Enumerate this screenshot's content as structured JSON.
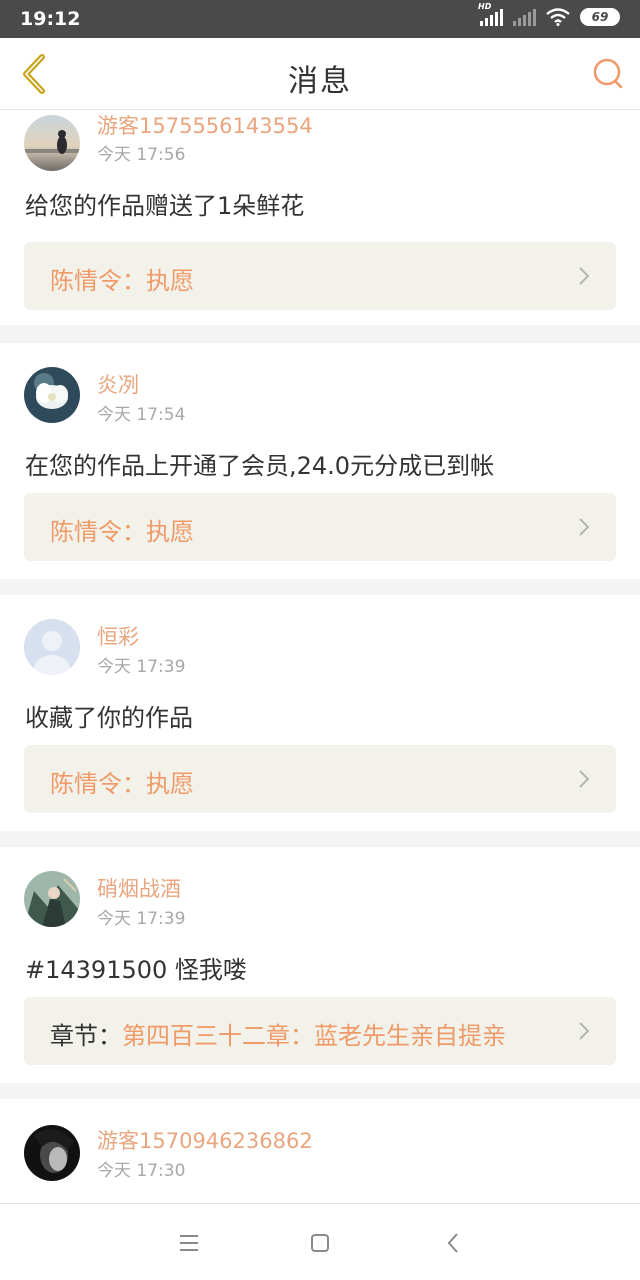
{
  "status_bar": {
    "time": "19:12",
    "hd_label": "HD",
    "battery": "69",
    "icons": [
      "signal-icon",
      "signal-disabled-icon",
      "wifi-icon",
      "battery-icon"
    ]
  },
  "header": {
    "title": "消息",
    "back_icon": "back-arrow-icon",
    "search_icon": "search-icon"
  },
  "notifications": [
    {
      "user": "游客1575556143554",
      "time": "今天 17:56",
      "message": "给您的作品赠送了1朵鲜花",
      "link_prefix": "",
      "link_text": "陈情令：执愿",
      "avatar": "avatar-photo-girl-sunset"
    },
    {
      "user": "炎冽",
      "time": "今天 17:54",
      "message": "在您的作品上开通了会员,24.0元分成已到帐",
      "link_prefix": "",
      "link_text": "陈情令：执愿",
      "avatar": "avatar-white-flower"
    },
    {
      "user": "恒彩",
      "time": "今天 17:39",
      "message": "收藏了你的作品",
      "link_prefix": "",
      "link_text": "陈情令：执愿",
      "avatar": "avatar-default-person"
    },
    {
      "user": "硝烟战酒",
      "time": "今天 17:39",
      "message": "#14391500 怪我喽",
      "link_prefix": "章节：",
      "link_text": "第四百三十二章：蓝老先生亲自提亲",
      "avatar": "avatar-illustration"
    },
    {
      "user": "游客1570946236862",
      "time": "今天 17:30",
      "message": "",
      "link_prefix": "",
      "link_text": "",
      "avatar": "avatar-dark-portrait"
    }
  ],
  "bottom_nav": {
    "icons": [
      "menu-icon",
      "home-square-icon",
      "back-triangle-icon"
    ]
  },
  "colors": {
    "accent": "#ef9a68",
    "username": "#e9a57e",
    "back_arrow": "#c9a419",
    "link_box_bg": "#f3f2ea",
    "status_bar_bg": "#4a4a4a"
  }
}
